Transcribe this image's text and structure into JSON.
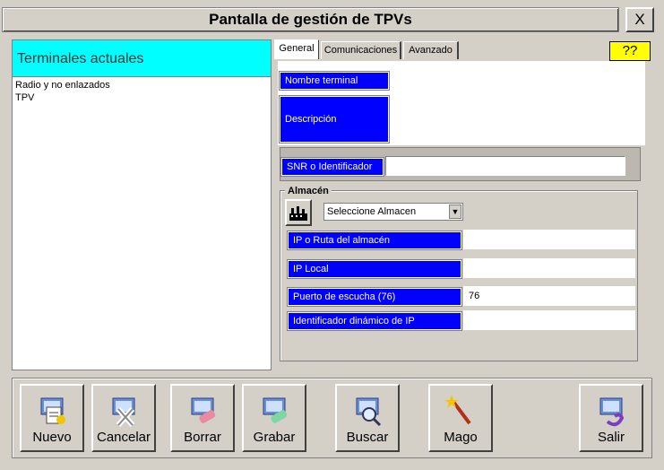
{
  "window": {
    "title": "Pantalla de gestión de TPVs",
    "close_label": "X"
  },
  "left_panel": {
    "header": "Terminales actuales",
    "items": [
      "Radio y no enlazados",
      "TPV"
    ]
  },
  "tabs": [
    {
      "label": "General",
      "active": true
    },
    {
      "label": "Comunicaciones",
      "active": false
    },
    {
      "label": "Avanzado",
      "active": false
    }
  ],
  "help_label": "??",
  "general": {
    "nombre_label": "Nombre terminal",
    "nombre_value": "",
    "descripcion_label": "Descripción",
    "descripcion_value": "",
    "snr_label": "SNR o Identificador",
    "snr_value": ""
  },
  "almacen": {
    "title": "Almacén",
    "select_value": "Seleccione Almacen",
    "ip_ruta_label": "IP o Ruta del almacén",
    "ip_ruta_value": "",
    "ip_local_label": "IP Local",
    "ip_local_value": "",
    "puerto_label": "Puerto de escucha (76)",
    "puerto_value": "76",
    "id_dinamico_label": "Identificador dinámico de IP",
    "id_dinamico_value": ""
  },
  "toolbar": {
    "nuevo": "Nuevo",
    "cancelar": "Cancelar",
    "borrar": "Borrar",
    "grabar": "Grabar",
    "buscar": "Buscar",
    "mago": "Mago",
    "salir": "Salir"
  },
  "colors": {
    "label_bg": "#0000ff",
    "header_bg": "#00ffff",
    "help_bg": "#ffff00",
    "window_bg": "#d4d0c8"
  }
}
